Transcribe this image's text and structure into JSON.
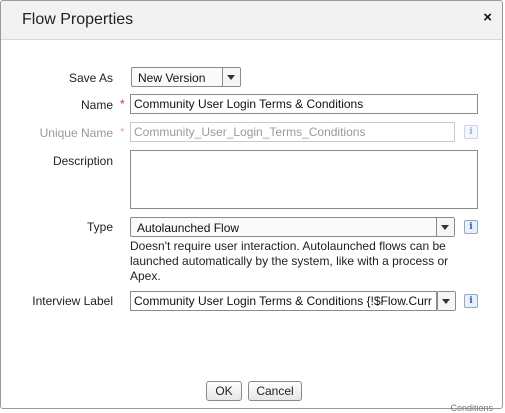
{
  "dialog": {
    "title": "Flow Properties",
    "close_label": "×"
  },
  "fields": {
    "save_as": {
      "label": "Save As",
      "value": "New Version"
    },
    "name": {
      "label": "Name",
      "required_mark": "*",
      "value": "Community User Login Terms & Conditions"
    },
    "unique_name": {
      "label": "Unique Name",
      "required_mark": "*",
      "value": "Community_User_Login_Terms_Conditions",
      "info": "i"
    },
    "description": {
      "label": "Description",
      "value": ""
    },
    "type": {
      "label": "Type",
      "value": "Autolaunched Flow",
      "info": "i",
      "help": "Doesn't require user interaction. Autolaunched flows can be launched automatically by the system, like with a process or Apex."
    },
    "interview_label": {
      "label": "Interview Label",
      "value": "Community User Login Terms & Conditions {!$Flow.Curr",
      "info": "i"
    }
  },
  "buttons": {
    "ok": "OK",
    "cancel": "Cancel"
  },
  "colors": {
    "required": "#c23934",
    "info_icon": "#2a63a8"
  },
  "background_fragment": "Conditions"
}
